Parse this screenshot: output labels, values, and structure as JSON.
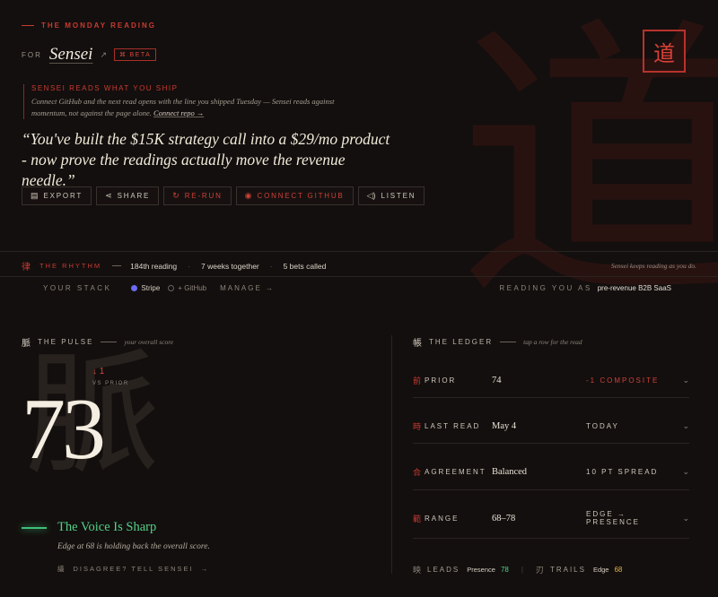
{
  "watermark": {
    "main": "道",
    "seal": "道",
    "pulse": "脈"
  },
  "kicker": "THE MONDAY READING",
  "for_label": "FOR",
  "user_name": "Sensei",
  "ext_icon": "↗",
  "beta": {
    "icon": "⌘",
    "label": "BETA"
  },
  "notice": {
    "title": "SENSEI READS WHAT YOU SHIP",
    "body": "Connect GitHub and the next read opens with the line you shipped Tuesday — Sensei reads against momentum, not against the page alone.",
    "link": "Connect repo →"
  },
  "quote": "“You've built the $15K strategy call into a $29/mo product - now prove the readings actually move the revenue needle.”",
  "actions": [
    {
      "icon": "▤",
      "label": "EXPORT"
    },
    {
      "icon": "⋖",
      "label": "SHARE"
    },
    {
      "icon": "↻",
      "label": "RE-RUN"
    },
    {
      "icon": "◉",
      "label": "CONNECT GITHUB"
    },
    {
      "icon": "◁)",
      "label": "LISTEN"
    }
  ],
  "rhythm": {
    "glyph": "律",
    "label": "THE RHYTHM",
    "stats": [
      "184th reading",
      "7 weeks together",
      "5 bets called"
    ],
    "note": "Sensei keeps reading as you do."
  },
  "stack": {
    "label": "YOUR STACK",
    "items": [
      {
        "label": "Stripe",
        "on": true
      },
      {
        "label": "+ GitHub",
        "on": false
      }
    ],
    "manage": "MANAGE →",
    "reading_as_label": "READING YOU AS",
    "reading_as_value": "pre-revenue B2B SaaS"
  },
  "pulse": {
    "glyph": "脈",
    "title": "THE PULSE",
    "subtitle": "your overall score",
    "score": "73",
    "delta": "↓ 1",
    "delta_label": "VS PRIOR",
    "voice_title": "The Voice Is Sharp",
    "voice_body": "Edge at 68 is holding back the overall score.",
    "disagree_glyph": "議",
    "disagree": "DISAGREE? TELL SENSEI",
    "disagree_arrow": "→"
  },
  "ledger": {
    "glyph": "帳",
    "title": "THE LEDGER",
    "subtitle": "tap a row for the read",
    "rows": [
      {
        "glyph": "前",
        "key": "PRIOR",
        "value": "74",
        "note": "-1 COMPOSITE",
        "chev": "⌄"
      },
      {
        "glyph": "時",
        "key": "LAST READ",
        "value": "May 4",
        "note": "TODAY",
        "chev": "⌄"
      },
      {
        "glyph": "合",
        "key": "AGREEMENT",
        "value": "Balanced",
        "note": "10 PT SPREAD",
        "chev": "⌄"
      },
      {
        "glyph": "範",
        "key": "RANGE",
        "value": "68–78",
        "note": "EDGE → PRESENCE",
        "chev": "⌄"
      }
    ],
    "leads": {
      "glyph": "映",
      "label": "LEADS",
      "name": "Presence",
      "value": "78"
    },
    "trails": {
      "glyph": "刃",
      "label": "TRAILS",
      "name": "Edge",
      "value": "68"
    }
  },
  "colors": {
    "accent": "#c93a31",
    "positive": "#52d088",
    "warning": "#e0b348",
    "background": "#130f0e"
  }
}
